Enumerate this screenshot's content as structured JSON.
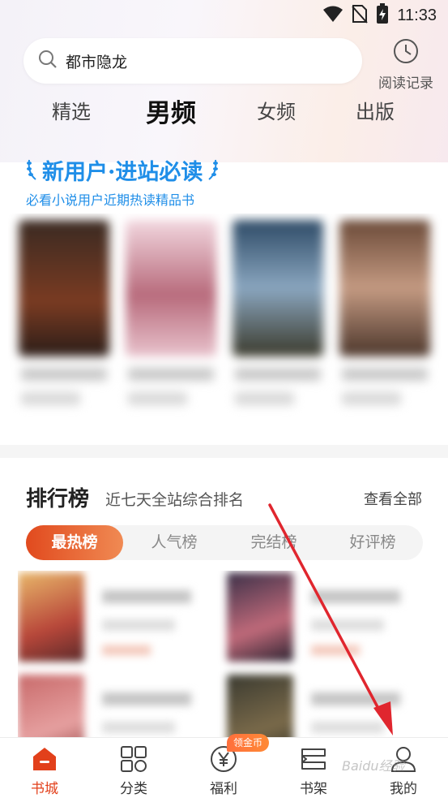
{
  "status_bar": {
    "time": "11:33"
  },
  "search": {
    "query": "都市隐龙"
  },
  "history": {
    "label": "阅读记录"
  },
  "tabs": [
    {
      "label": "精选"
    },
    {
      "label": "男频"
    },
    {
      "label": "女频"
    },
    {
      "label": "出版"
    }
  ],
  "promo": {
    "title": "新用户·进站必读",
    "subtitle": "必看小说用户近期热读精品书"
  },
  "ranking": {
    "title": "排行榜",
    "description": "近七天全站综合排名",
    "see_all": "查看全部",
    "tabs": [
      {
        "label": "最热榜"
      },
      {
        "label": "人气榜"
      },
      {
        "label": "完结榜"
      },
      {
        "label": "好评榜"
      }
    ]
  },
  "bottom_nav": {
    "items": [
      {
        "label": "书城",
        "icon": "home-icon"
      },
      {
        "label": "分类",
        "icon": "category-grid-icon"
      },
      {
        "label": "福利",
        "icon": "yen-coin-icon"
      },
      {
        "label": "书架",
        "icon": "bookshelf-icon"
      },
      {
        "label": "我的",
        "icon": "user-icon"
      }
    ],
    "badge": "领金币"
  },
  "watermark": "Baidu经验",
  "colors": {
    "accent": "#e2401b",
    "promo_blue": "#1f8ee8",
    "annotation_arrow": "#e0262e"
  }
}
